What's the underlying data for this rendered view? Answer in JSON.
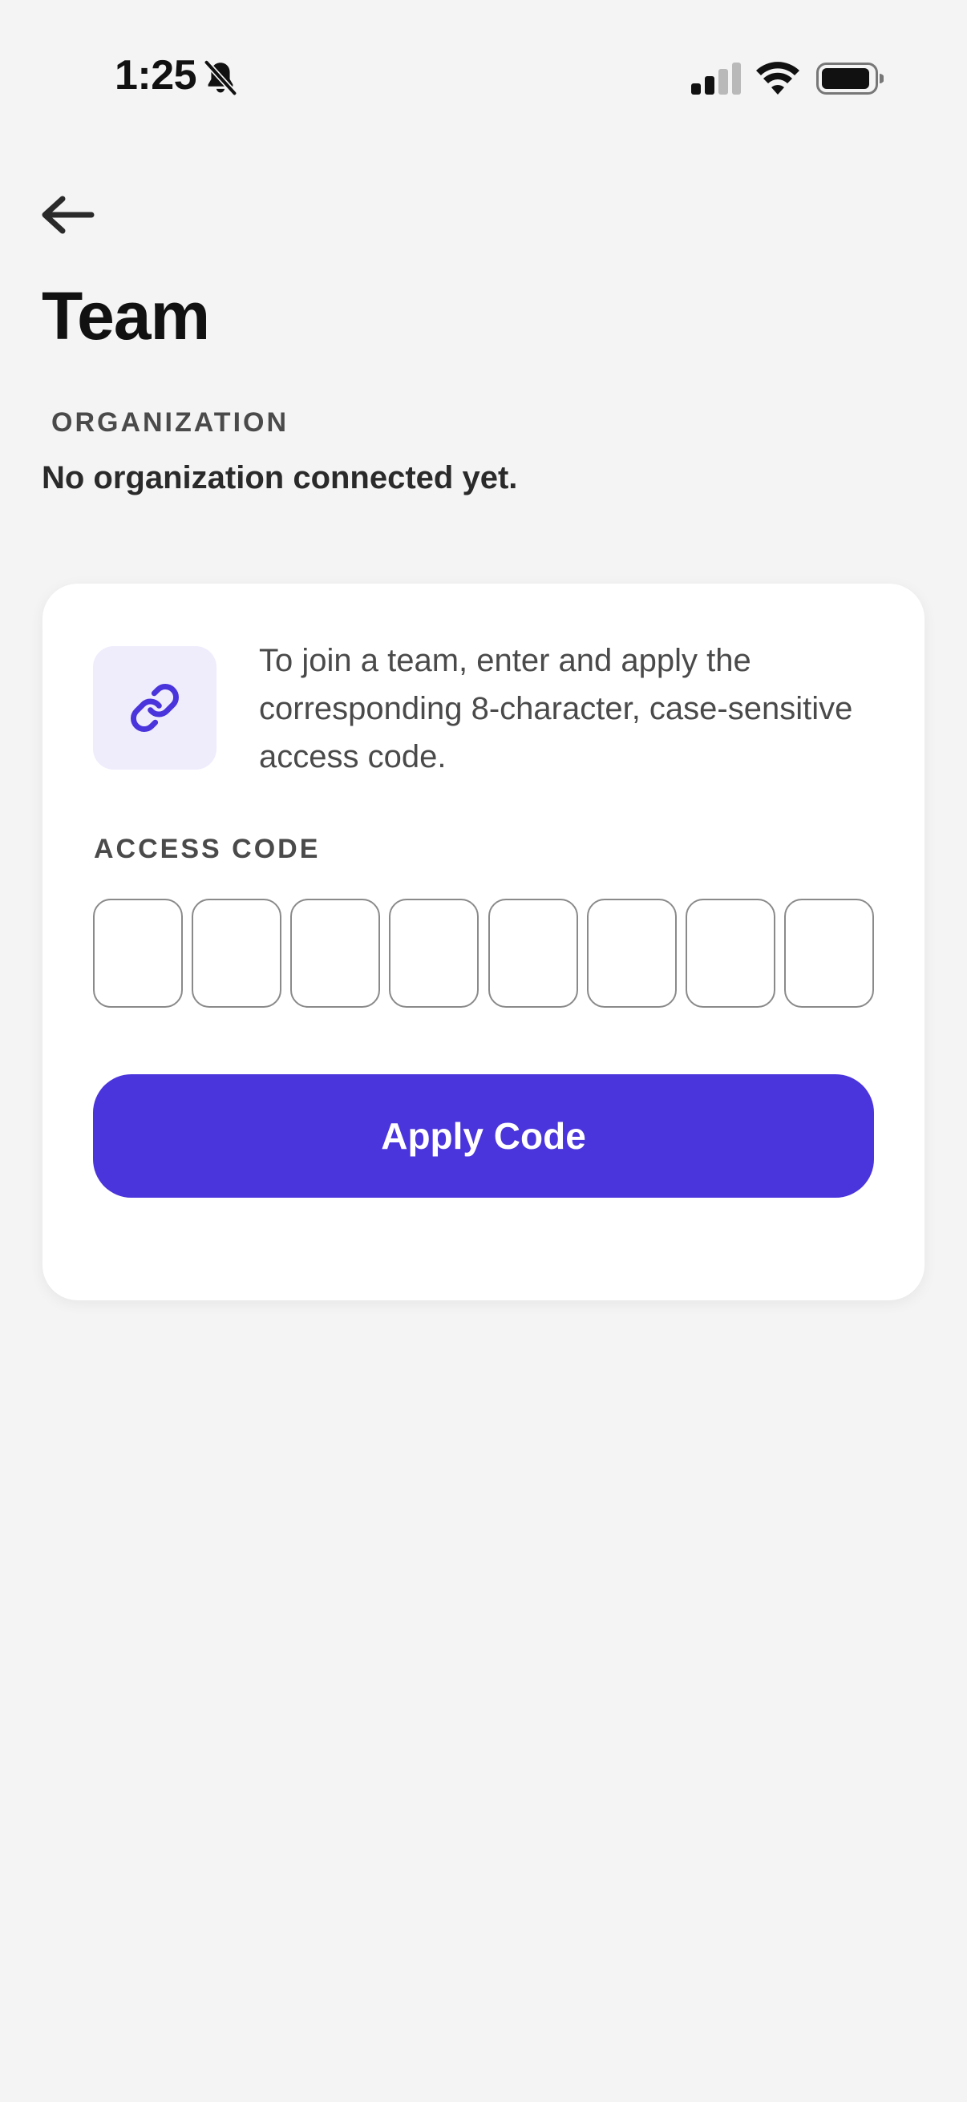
{
  "status_bar": {
    "time": "1:25",
    "icons": [
      "bell-off-icon",
      "signal-icon",
      "wifi-icon",
      "battery-icon"
    ]
  },
  "header": {
    "back_icon": "arrow-left-icon",
    "title": "Team"
  },
  "organization": {
    "label": "ORGANIZATION",
    "status": "No organization connected yet."
  },
  "join_card": {
    "icon": "link-icon",
    "description": "To join a team, enter and apply the corresponding 8-character, case-sensitive access code.",
    "access_code_label": "ACCESS CODE",
    "code_values": [
      "",
      "",
      "",
      "",
      "",
      "",
      "",
      ""
    ],
    "apply_label": "Apply Code"
  },
  "colors": {
    "background": "#f4f4f4",
    "card": "#ffffff",
    "accent": "#4a34db",
    "icon_tile": "#efecfc"
  }
}
